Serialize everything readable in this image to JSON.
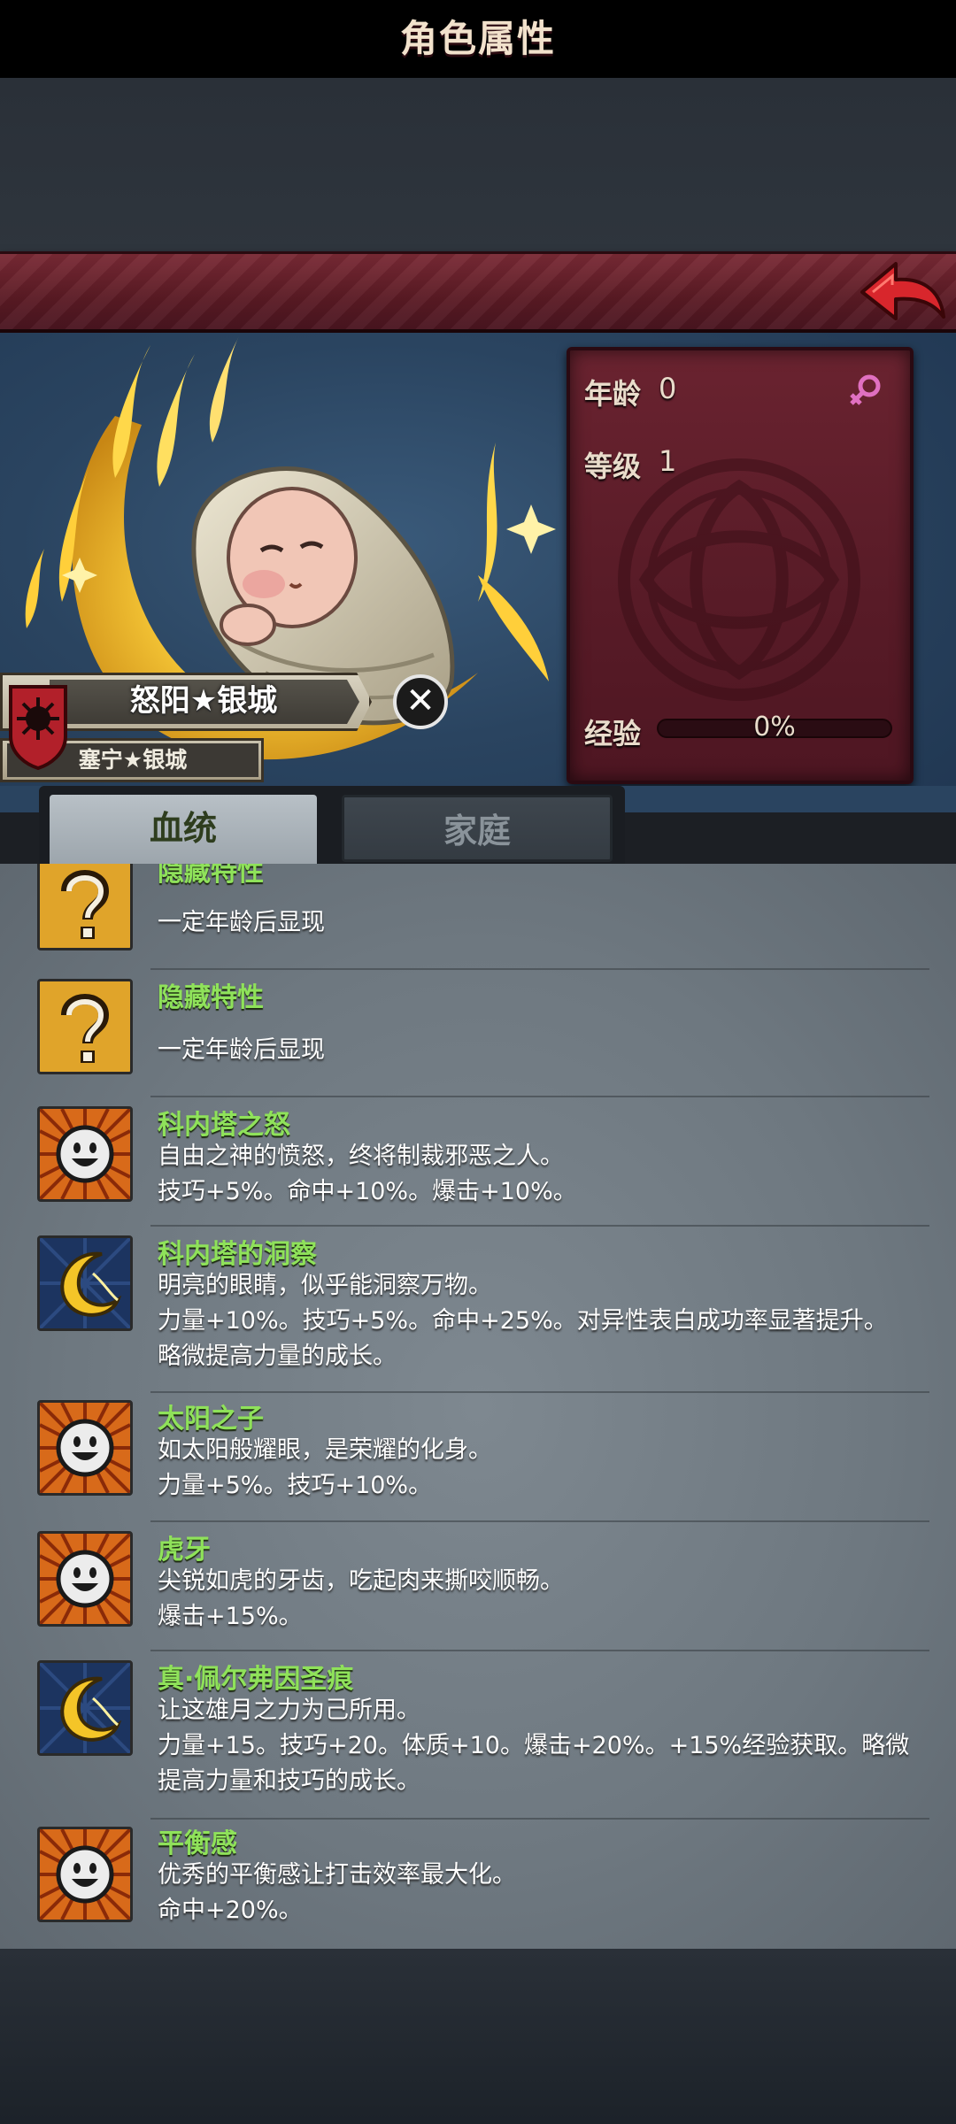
{
  "header": {
    "title": "角色属性"
  },
  "character": {
    "name": "怒阳★银城",
    "subtitle": "塞宁★银城"
  },
  "stats": {
    "age_label": "年龄",
    "age_value": "0",
    "level_label": "等级",
    "level_value": "1",
    "exp_label": "经验",
    "exp_value": "0%",
    "exp_progress": 0,
    "gender": "female"
  },
  "tabs": [
    {
      "label": "血统",
      "active": true
    },
    {
      "label": "家庭",
      "active": false
    }
  ],
  "traits": [
    {
      "icon": "question-icon",
      "name": "隐藏特性",
      "lines": [
        "一定年龄后显现"
      ]
    },
    {
      "icon": "question-icon",
      "name": "隐藏特性",
      "lines": [
        "一定年龄后显现"
      ]
    },
    {
      "icon": "sun-icon",
      "name": "科内塔之怒",
      "lines": [
        "自由之神的愤怒，终将制裁邪恶之人。",
        "技巧+5%。命中+10%。爆击+10%。"
      ]
    },
    {
      "icon": "moon-icon",
      "name": "科内塔的洞察",
      "lines": [
        "明亮的眼睛，似乎能洞察万物。",
        "力量+10%。技巧+5%。命中+25%。对异性表白成功率显著提升。",
        "略微提高力量的成长。"
      ]
    },
    {
      "icon": "sun-icon",
      "name": "太阳之子",
      "lines": [
        "如太阳般耀眼，是荣耀的化身。",
        "力量+5%。技巧+10%。"
      ]
    },
    {
      "icon": "sun-icon",
      "name": "虎牙",
      "lines": [
        "尖锐如虎的牙齿，吃起肉来撕咬顺畅。",
        "爆击+15%。"
      ]
    },
    {
      "icon": "moon-icon",
      "name": "真·佩尔弗因圣痕",
      "lines": [
        "让这雄月之力为己所用。",
        "力量+15。技巧+20。体质+10。爆击+20%。+15%经验获取。略微",
        "提高力量和技巧的成长。"
      ]
    },
    {
      "icon": "sun-icon",
      "name": "平衡感",
      "lines": [
        "优秀的平衡感让打击效率最大化。",
        "命中+20%。"
      ]
    }
  ],
  "colors": {
    "trait_name": "#8fe25a",
    "header_bg": "#6a2330",
    "gender_icon": "#e070c0"
  }
}
